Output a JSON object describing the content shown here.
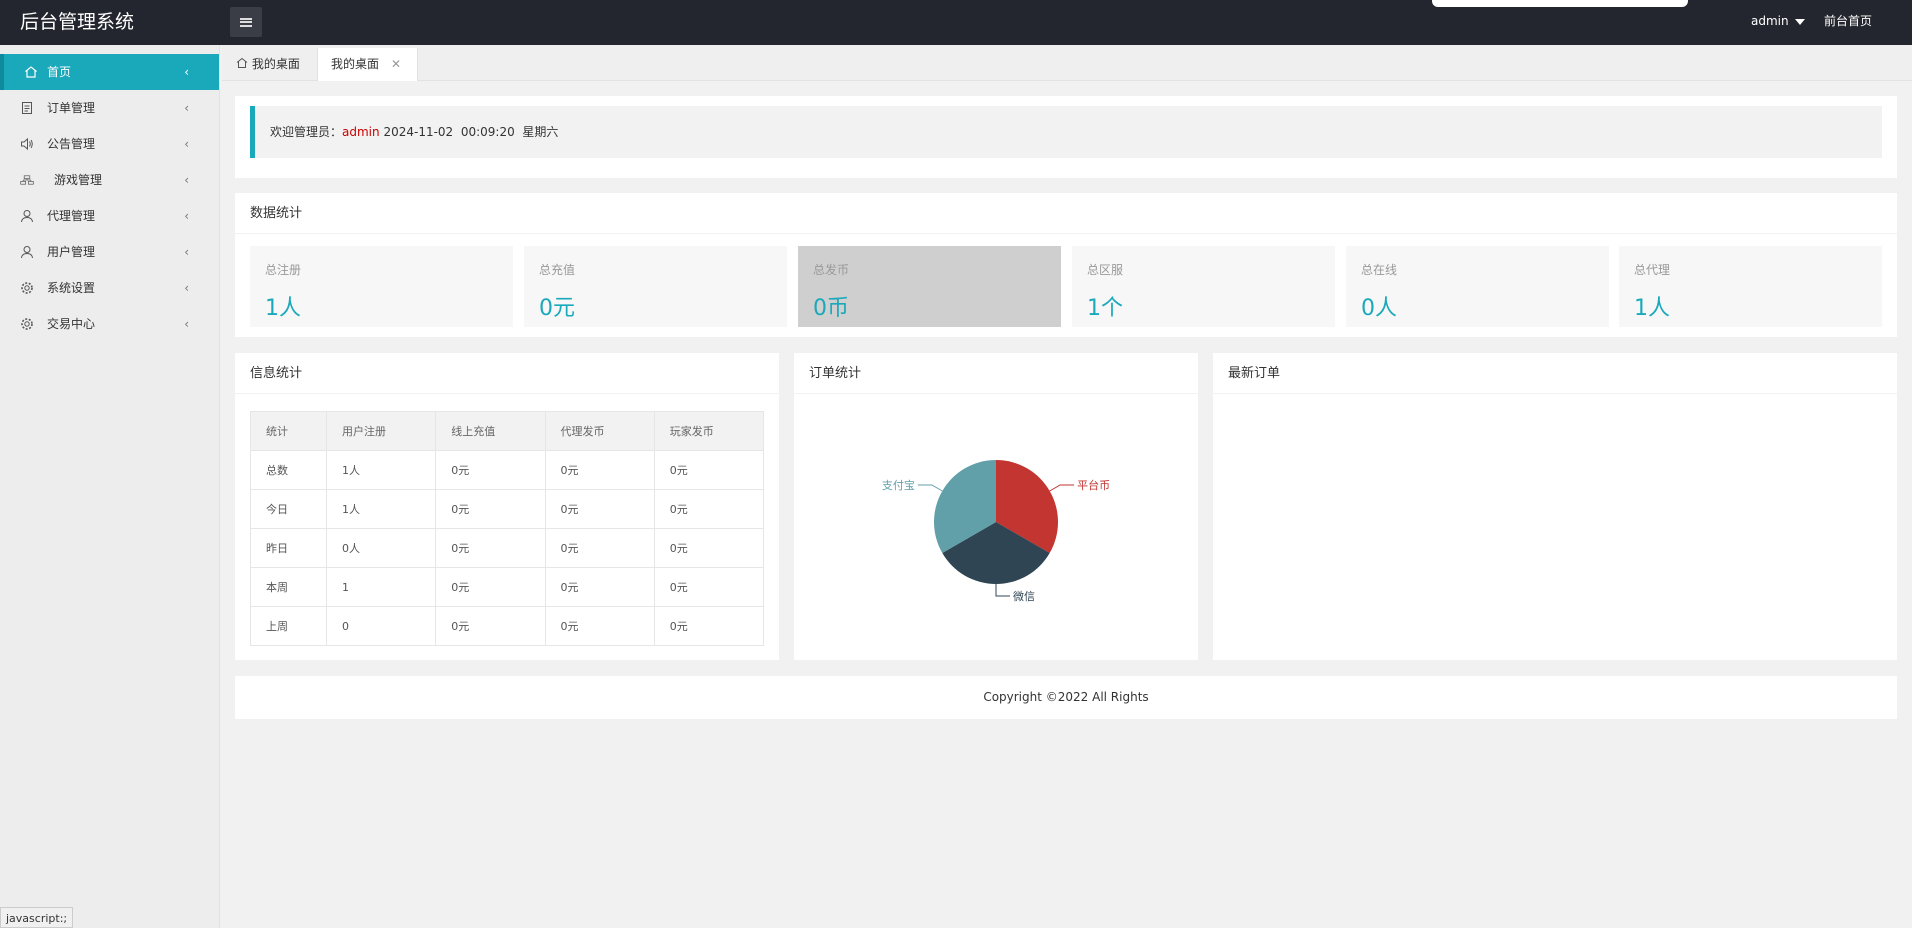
{
  "app": {
    "title": "后台管理系统",
    "user_name": "admin",
    "front_link": "前台首页"
  },
  "sidebar": {
    "items": [
      {
        "label": "首页",
        "icon": "home-icon",
        "active": true
      },
      {
        "label": "订单管理",
        "icon": "document-icon"
      },
      {
        "label": "公告管理",
        "icon": "speaker-icon"
      },
      {
        "label": "游戏管理",
        "icon": "sitemap-icon"
      },
      {
        "label": "代理管理",
        "icon": "user-icon"
      },
      {
        "label": "用户管理",
        "icon": "user-icon"
      },
      {
        "label": "系统设置",
        "icon": "gear-icon"
      },
      {
        "label": "交易中心",
        "icon": "gear-icon"
      }
    ]
  },
  "tabs": {
    "home_label": "我的桌面",
    "active_label": "我的桌面",
    "close_glyph": "✕"
  },
  "welcome": {
    "prefix": "欢迎管理员：",
    "admin": "admin",
    "datetime": "2024-11-02  00:09:20  星期六"
  },
  "stats": {
    "title": "数据统计",
    "items": [
      {
        "label": "总注册",
        "value": "1人"
      },
      {
        "label": "总充值",
        "value": "0元"
      },
      {
        "label": "总发币",
        "value": "0币",
        "highlight": true
      },
      {
        "label": "总区服",
        "value": "1个"
      },
      {
        "label": "总在线",
        "value": "0人"
      },
      {
        "label": "总代理",
        "value": "1人"
      }
    ]
  },
  "info": {
    "title": "信息统计",
    "headers": [
      "统计",
      "用户注册",
      "线上充值",
      "代理发币",
      "玩家发币"
    ],
    "rows": [
      [
        "总数",
        "1人",
        "0元",
        "0元",
        "0元"
      ],
      [
        "今日",
        "1人",
        "0元",
        "0元",
        "0元"
      ],
      [
        "昨日",
        "0人",
        "0元",
        "0元",
        "0元"
      ],
      [
        "本周",
        "1",
        "0元",
        "0元",
        "0元"
      ],
      [
        "上周",
        "0",
        "0元",
        "0元",
        "0元"
      ]
    ]
  },
  "orders": {
    "title": "订单统计"
  },
  "chart_data": {
    "type": "pie",
    "categories": [
      "平台币",
      "微信",
      "支付宝"
    ],
    "values": [
      1,
      1,
      1
    ],
    "colors": [
      "#c23531",
      "#2f4554",
      "#61a0a8"
    ]
  },
  "latest": {
    "title": "最新订单"
  },
  "footer": {
    "text": "Copyright ©2022 All Rights"
  },
  "status_bar": {
    "text": "javascript:;"
  },
  "colors": {
    "accent": "#1aa9bb",
    "header_bg": "#23262e",
    "admin_highlight": "#cc0000"
  }
}
